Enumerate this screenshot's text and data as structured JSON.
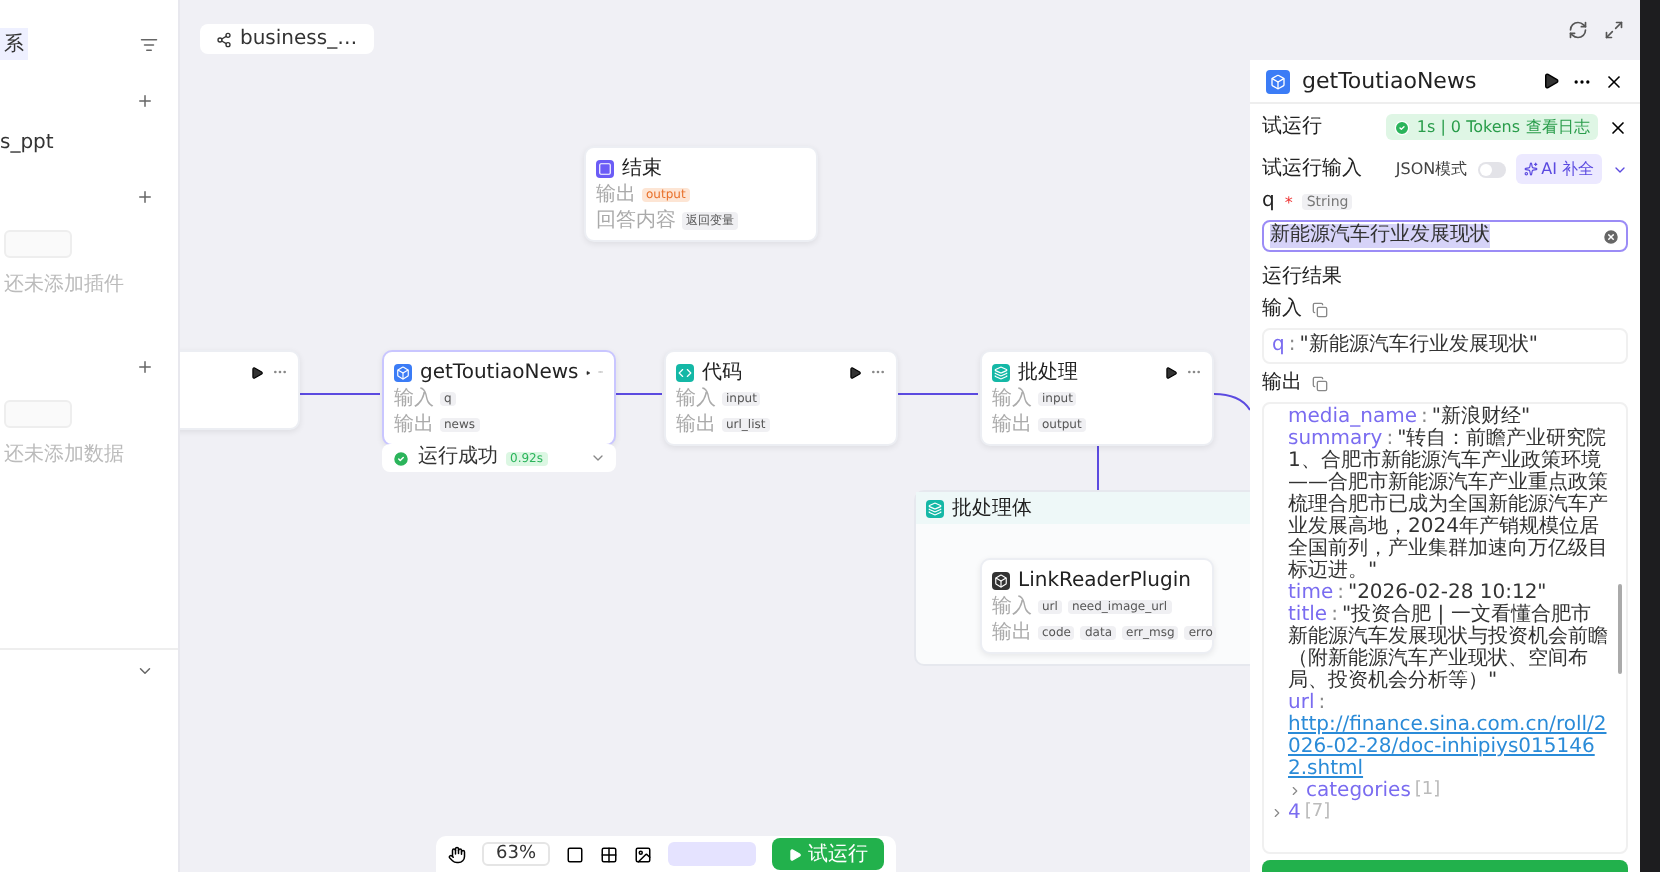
{
  "sidebar": {
    "tag": "系",
    "sections": [
      {
        "kind": "list",
        "items": [
          "s_ppt"
        ]
      },
      {
        "kind": "empty",
        "text": "还未添加插件"
      },
      {
        "kind": "empty",
        "text": "还未添加数据"
      }
    ]
  },
  "canvas": {
    "tab": "business_…",
    "nodes": [
      {
        "kind": "partial"
      },
      {
        "kind": "end",
        "title": "结束",
        "color": "#6b5cf6",
        "rows": [
          {
            "label": "输出",
            "tags": [
              "output"
            ],
            "accent": true
          },
          {
            "label": "回答内容",
            "tags": [
              "返回变量"
            ],
            "accent": false
          }
        ]
      },
      {
        "kind": "plugin",
        "title": "getToutiaoNews",
        "color": "#3b7cf6",
        "rows": [
          {
            "label": "输入",
            "tags": [
              "q"
            ],
            "accent": false
          },
          {
            "label": "输出",
            "tags": [
              "news"
            ],
            "accent": false
          }
        ],
        "status": {
          "text": "运行成功",
          "time": "0.92s"
        }
      },
      {
        "kind": "code",
        "title": "代码",
        "color": "#14b8a6",
        "rows": [
          {
            "label": "输入",
            "tags": [
              "input"
            ],
            "accent": false
          },
          {
            "label": "输出",
            "tags": [
              "url_list"
            ],
            "accent": false
          }
        ]
      },
      {
        "kind": "batch",
        "title": "批处理",
        "color": "#14b8a6",
        "rows": [
          {
            "label": "输入",
            "tags": [
              "input"
            ],
            "accent": false
          },
          {
            "label": "输出",
            "tags": [
              "output"
            ],
            "accent": false
          }
        ]
      }
    ],
    "batch_body": {
      "title": "批处理体",
      "child": {
        "title": "LinkReaderPlugin",
        "rows": [
          {
            "label": "输入",
            "tags": [
              "url",
              "need_image_url"
            ],
            "accent": false
          },
          {
            "label": "输出",
            "tags": [
              "code",
              "data",
              "err_msg",
              "erro"
            ],
            "accent": false
          }
        ]
      }
    },
    "toolbar": {
      "zoom": "63%",
      "run_button": "试运行"
    }
  },
  "panel": {
    "title": "getToutiaoNews",
    "test_run": {
      "title": "试运行",
      "badge": "1s | 0 Tokens",
      "log_link": "查看日志",
      "input_title": "试运行输入",
      "json_mode": {
        "label": "JSON模式",
        "on": false
      },
      "ai_button": "AI 补全",
      "param": {
        "name": "q",
        "required_mark": "*",
        "type": "String",
        "value": "新能源汽车行业发展现状"
      },
      "result_title": "运行结果",
      "input_label": "输入",
      "input_value": {
        "key": "q",
        "sep": ":",
        "value": "\"新能源汽车行业发展现状\""
      },
      "output_label": "输出",
      "output": [
        {
          "kind": "group",
          "children": [
            {
              "kind": "field",
              "key": "media_name",
              "sep": ":",
              "value": "\"新浪财经\""
            },
            {
              "kind": "field",
              "key": "summary",
              "sep": ":",
              "value": "\"转自：前瞻产业研究院1、合肥市新能源汽车产业政策环境——合肥市新能源汽车产业重点政策梳理合肥市已成为全国新能源汽车产业发展高地，2024年产销规模位居全国前列，产业集群加速向万亿级目标迈进。\""
            },
            {
              "kind": "field",
              "key": "time",
              "sep": ":",
              "value": "\"2026-02-28 10:12\""
            },
            {
              "kind": "field",
              "key": "title",
              "sep": ":",
              "value": "\"投资合肥 | 一文看懂合肥市新能源汽车发展现状与投资机会前瞻（附新能源汽车产业现状、空间布局、投资机会分析等）\""
            },
            {
              "kind": "link",
              "key": "url",
              "sep": ":",
              "value": "http://finance.sina.com.cn/roll/2026-02-28/doc-inhipiys0151462.shtml"
            },
            {
              "kind": "group",
              "key": "categories",
              "count": "[1]",
              "expanded": false
            }
          ]
        },
        {
          "kind": "group",
          "key": "4",
          "count": "[7]",
          "expanded": false
        }
      ]
    }
  }
}
